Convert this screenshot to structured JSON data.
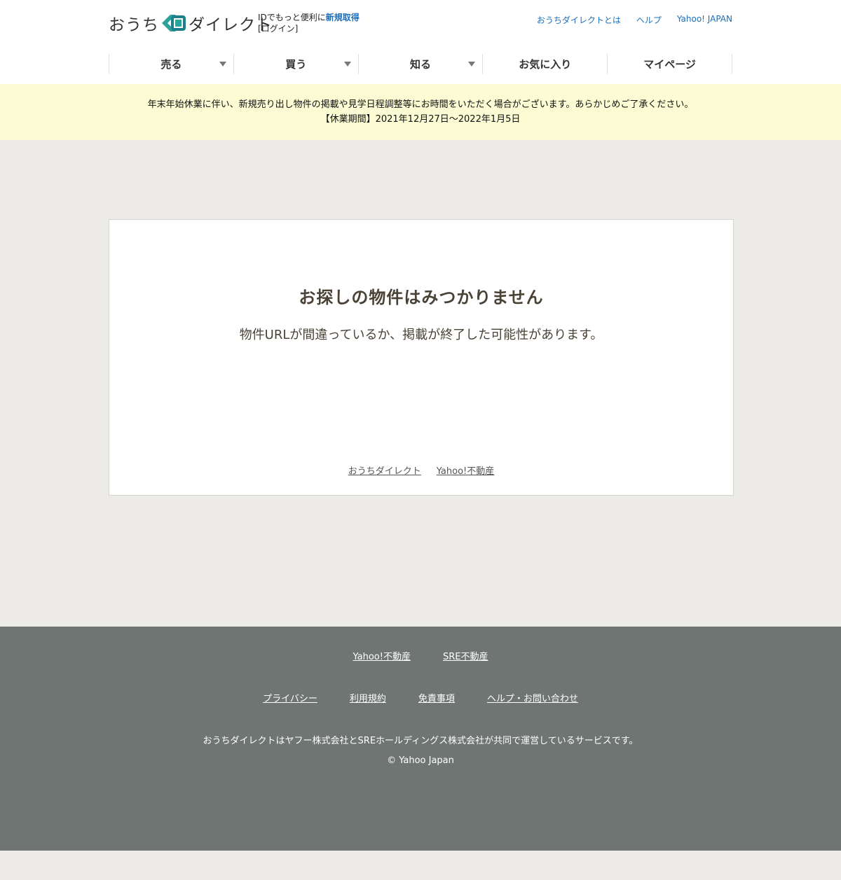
{
  "header": {
    "logo_text_left": "おうち",
    "logo_text_right": "ダイレクト",
    "login_prefix": "IDでもっと便利に",
    "signup_label": "新規取得",
    "login_label": "[ログイン]",
    "top_links": [
      "おうちダイレクトとは",
      "ヘルプ",
      "Yahoo! JAPAN"
    ]
  },
  "nav": [
    {
      "label": "売る"
    },
    {
      "label": "買う"
    },
    {
      "label": "知る"
    },
    {
      "label": "お気に入り"
    },
    {
      "label": "マイページ"
    }
  ],
  "notice": {
    "line1": "年末年始休業に伴い、新規売り出し物件の掲載や見学日程調整等にお時間をいただく場合がございます。あらかじめご了承ください。",
    "line2": "【休業期間】2021年12月27日～2022年1月5日"
  },
  "main": {
    "title": "お探しの物件はみつかりません",
    "subtitle": "物件URLが間違っているか、掲載が終了した可能性があります。",
    "links": [
      "おうちダイレクト",
      "Yahoo!不動産"
    ]
  },
  "footer": {
    "row1": [
      "Yahoo!不動産",
      "SRE不動産"
    ],
    "row2": [
      "プライバシー",
      "利用規約",
      "免責事項",
      "ヘルプ・お問い合わせ"
    ],
    "description": "おうちダイレクトはヤフー株式会社とSREホールディングス株式会社が共同で運営しているサービスです。",
    "copyright": "© Yahoo Japan"
  },
  "colors": {
    "link": "#1a6fbb",
    "notice_bg": "#fbfcd3",
    "footer_bg": "#6e7572",
    "logo_teal": "#2ba39a"
  }
}
